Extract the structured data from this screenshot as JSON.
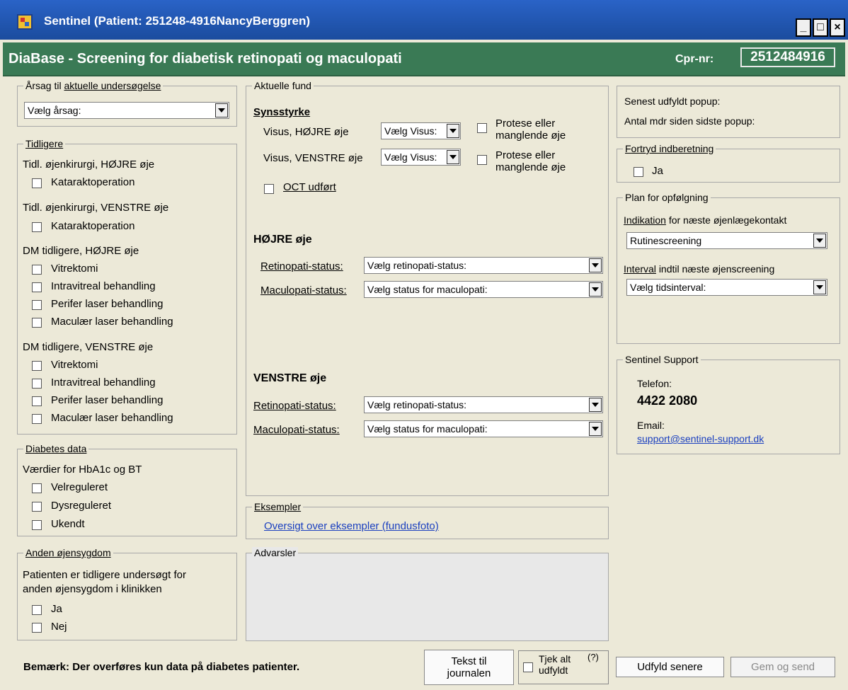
{
  "window": {
    "title": "Sentinel (Patient: 251248-4916NancyBerggren)",
    "min": "_",
    "max": "□",
    "close": "×"
  },
  "header": {
    "title": "DiaBase - Screening for diabetisk retinopati og maculopati",
    "cpr_label": "Cpr-nr:",
    "cpr_value": "2512484916"
  },
  "reason": {
    "label_a": "Årsag til",
    "label_b": "aktuelle undersøgelse",
    "select": "Vælg årsag:"
  },
  "previous": {
    "group": "Tidligere",
    "surg_right": "Tidl. øjenkirurgi, HØJRE øje",
    "surg_right_item": "Kataraktoperation",
    "surg_left": "Tidl. øjenkirurgi, VENSTRE øje",
    "surg_left_item": "Kataraktoperation",
    "dm_right": "DM tidligere, HØJRE øje",
    "dm_right_items": [
      "Vitrektomi",
      "Intravitreal behandling",
      "Perifer laser behandling",
      "Maculær laser behandling"
    ],
    "dm_left": "DM tidligere, VENSTRE øje",
    "dm_left_items": [
      "Vitrektomi",
      "Intravitreal behandling",
      "Perifer laser behandling",
      "Maculær laser behandling"
    ]
  },
  "diabetes": {
    "group": "Diabetes data",
    "label": "Værdier for HbA1c og BT",
    "items": [
      "Velreguleret",
      "Dysreguleret",
      "Ukendt"
    ]
  },
  "other_eye": {
    "group": "Anden øjensygdom",
    "line1": "Patienten er tidligere undersøgt for",
    "line2": "anden øjensygdom i klinikken",
    "items": [
      "Ja",
      "Nej"
    ]
  },
  "findings": {
    "group": "Aktuelle fund",
    "vision_heading": "Synsstyrke",
    "visus_right": "Visus, HØJRE øje",
    "visus_left": "Visus, VENSTRE øje",
    "visus_select": "Vælg Visus:",
    "prosthesis_l1": "Protese eller",
    "prosthesis_l2": "manglende øje",
    "oct": "OCT udført",
    "right_heading": "HØJRE øje",
    "left_heading": "VENSTRE øje",
    "retino_label": "Retinopati-status:",
    "retino_select": "Vælg retinopati-status:",
    "maculo_label": "Maculopati-status:",
    "maculo_select": "Vælg status for maculopati:"
  },
  "examples": {
    "group": "Eksempler",
    "link": "Oversigt over eksempler (fundusfoto)"
  },
  "warnings": {
    "group": "Advarsler"
  },
  "popup": {
    "line1": "Senest udfyldt popup:",
    "line2": "Antal mdr siden sidste popup:"
  },
  "undo": {
    "group": "Fortryd indberetning",
    "item": "Ja"
  },
  "plan": {
    "group": "Plan for opfølgning",
    "ind_a": "Indikation",
    "ind_b": "for næste øjenlægekontakt",
    "ind_select": "Rutinescreening",
    "int_a": "Interval",
    "int_b": "indtil næste øjenscreening",
    "int_select": "Vælg tidsinterval:"
  },
  "support": {
    "group": "Sentinel Support",
    "phone_label": "Telefon:",
    "phone": "4422 2080",
    "email_label": "Email:",
    "email": "support@sentinel-support.dk"
  },
  "footer": {
    "note": "Bemærk: Der overføres kun data på diabetes patienter.",
    "journal_l1": "Tekst til",
    "journal_l2": "journalen",
    "check_l1": "Tjek alt",
    "check_l2": "udfyldt",
    "help": "(?)",
    "later": "Udfyld senere",
    "save": "Gem og send"
  }
}
